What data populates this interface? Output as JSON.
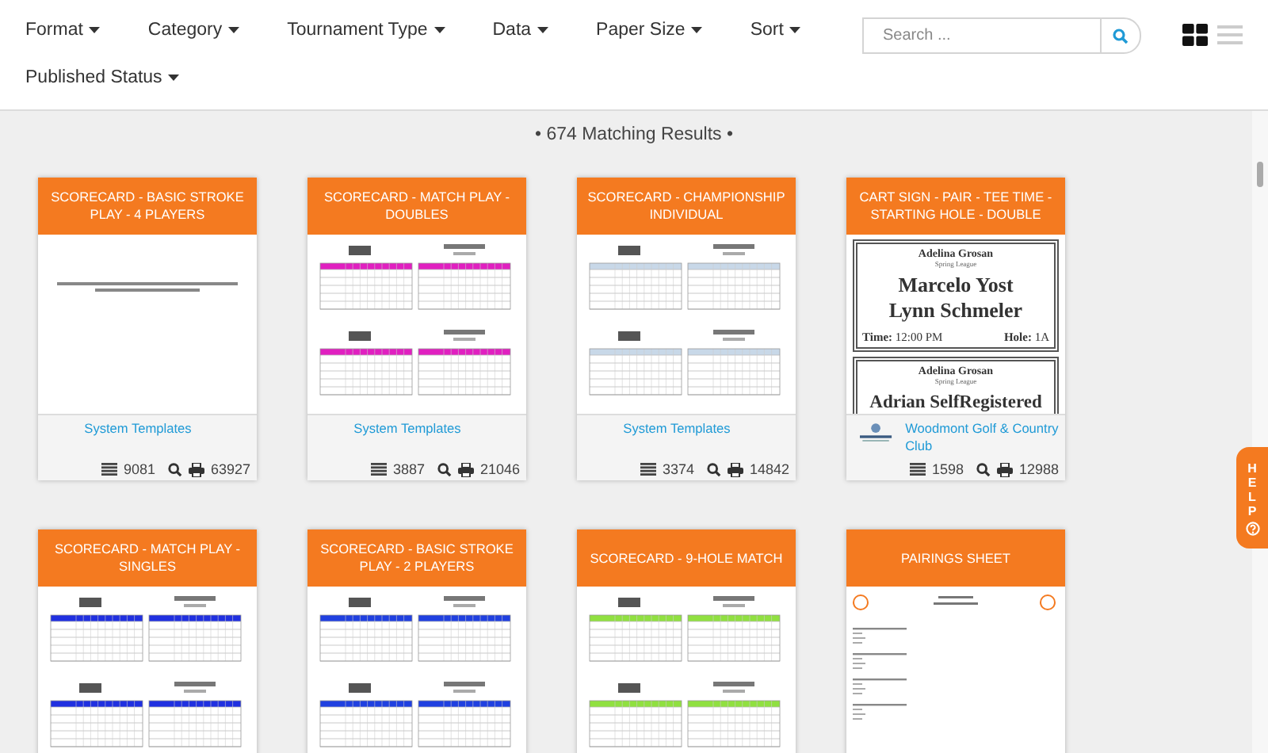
{
  "filters": [
    {
      "label": "Format"
    },
    {
      "label": "Category"
    },
    {
      "label": "Tournament Type"
    },
    {
      "label": "Data"
    },
    {
      "label": "Paper Size"
    },
    {
      "label": "Sort"
    },
    {
      "label": "Published Status"
    }
  ],
  "search": {
    "placeholder": "Search ..."
  },
  "view_toggle": {
    "grid_selected": true
  },
  "help": {
    "label": "HELP"
  },
  "results": "• 674 Matching Results •",
  "cards": [
    {
      "title": "SCORECARD - BASIC STROKE PLAY - 4 PLAYERS",
      "preview": {
        "kind": "notice"
      },
      "source": "System Templates",
      "logo": false,
      "uses": "9081",
      "prints": "63927"
    },
    {
      "title": "SCORECARD - MATCH PLAY - DOUBLES",
      "preview": {
        "kind": "scorecard",
        "color": "#e020c0"
      },
      "source": "System Templates",
      "logo": false,
      "uses": "3887",
      "prints": "21046"
    },
    {
      "title": "SCORECARD - CHAMPIONSHIP INDIVIDUAL",
      "preview": {
        "kind": "scorecard",
        "color": "#c8d8e8"
      },
      "source": "System Templates",
      "logo": false,
      "uses": "3374",
      "prints": "14842"
    },
    {
      "title": "CART SIGN - PAIR - TEE TIME - STARTING HOLE - DOUBLE",
      "preview": {
        "kind": "cart-sign",
        "signs": [
          {
            "host": "Adelina Grosan",
            "league": "Spring League",
            "players": [
              "Marcelo Yost",
              "Lynn Schmeler"
            ],
            "time_label": "Time:",
            "time": "12:00 PM",
            "hole_label": "Hole:",
            "hole": "1A"
          },
          {
            "host": "Adelina Grosan",
            "league": "Spring League",
            "players": [
              "Adrian SelfRegistered"
            ]
          }
        ]
      },
      "source": "Woodmont Golf & Country Club",
      "logo": true,
      "uses": "1598",
      "prints": "12988"
    },
    {
      "title": "SCORECARD - MATCH PLAY - SINGLES",
      "preview": {
        "kind": "scorecard",
        "color": "#2030e0"
      }
    },
    {
      "title": "SCORECARD - BASIC STROKE PLAY - 2 PLAYERS",
      "preview": {
        "kind": "scorecard",
        "color": "#2040e0"
      }
    },
    {
      "title": "SCORECARD - 9-HOLE MATCH",
      "preview": {
        "kind": "scorecard",
        "color": "#90e040"
      }
    },
    {
      "title": "PAIRINGS SHEET",
      "preview": {
        "kind": "pairings"
      }
    }
  ]
}
